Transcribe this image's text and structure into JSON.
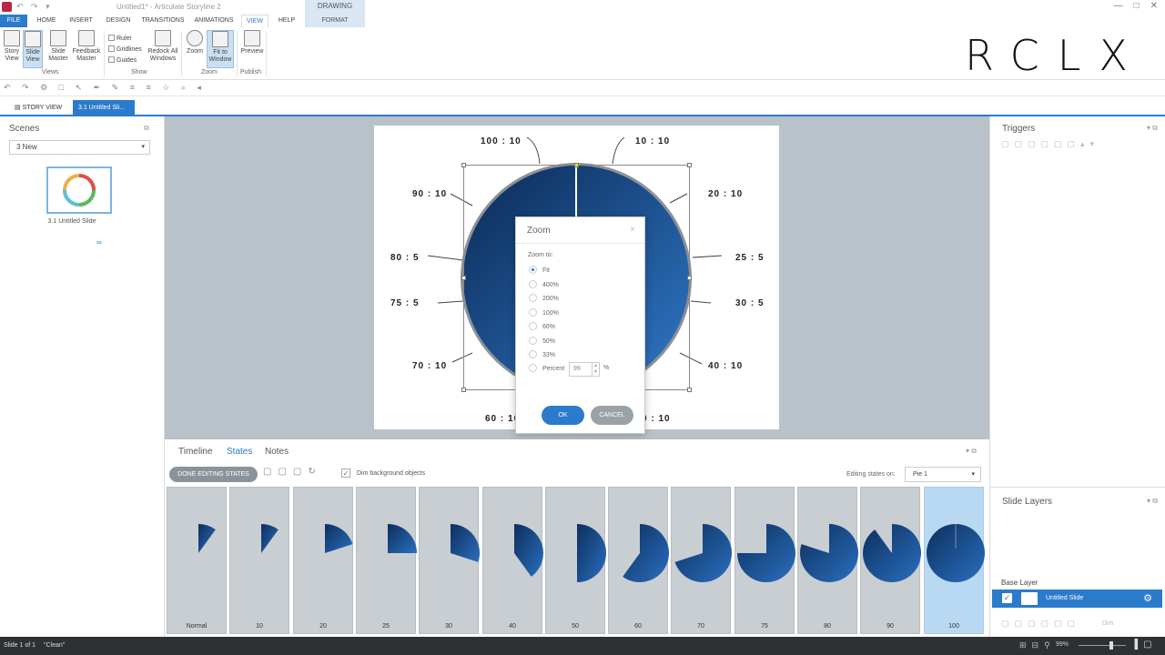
{
  "window": {
    "title": "Untitled1* - Articulate Storyline 2",
    "qat": "↶ ↷ ▾",
    "controls": [
      "—",
      "□",
      "✕"
    ],
    "contextual_group": "DRAWING TOOLS"
  },
  "ribbon_tabs": [
    "FILE",
    "HOME",
    "INSERT",
    "DESIGN",
    "TRANSITIONS",
    "ANIMATIONS",
    "VIEW",
    "HELP",
    "FORMAT"
  ],
  "ribbon": {
    "views_buttons": [
      {
        "label": "Story\nView"
      },
      {
        "label": "Slide\nView"
      },
      {
        "label": "Slide\nMaster"
      },
      {
        "label": "Feedback\nMaster"
      }
    ],
    "views_group": "Views",
    "show_checks": [
      "Ruler",
      "Gridlines",
      "Guides"
    ],
    "redock_label": "Redock All\nWindows",
    "show_group": "Show",
    "zoom_buttons": [
      {
        "label": "Zoom"
      },
      {
        "label": "Fit to\nWindow"
      }
    ],
    "zoom_group": "Zoom",
    "preview_label": "Preview",
    "publish_group": "Publish",
    "brand_logo": "RCLX"
  },
  "toolbar_icons": "↶ ↷ ⚙ □ ↖ ✒ ✎ ≡ ≡ ☆ ⌕ ◂",
  "doc_tabs": {
    "story": "STORY VIEW",
    "slide": "3.1 Untitled Sli..."
  },
  "scenes": {
    "title": "Scenes",
    "selected": "3 New",
    "thumb_label": "3.1 Untitled Slide"
  },
  "slide_labels": {
    "l100": "100 : 10",
    "l10": "10 : 10",
    "l90": "90 : 10",
    "l20": "20 : 10",
    "l80": "80 : 5",
    "l25": "25 : 5",
    "l75": "75 : 5",
    "l30": "30 : 5",
    "l70": "70 : 10",
    "l40": "40 : 10",
    "l60": "60 : 10",
    "l50": "0 : 10"
  },
  "zoom_dialog": {
    "title": "Zoom",
    "close": "×",
    "zoom_to": "Zoom to:",
    "options": [
      "Fit",
      "400%",
      "200%",
      "100%",
      "66%",
      "50%",
      "33%",
      "Percent"
    ],
    "selected_option": "Fit",
    "percent_value": "99",
    "percent_unit": "%",
    "ok": "OK",
    "cancel": "CANCEL"
  },
  "bottom": {
    "tabs": [
      "Timeline",
      "States",
      "Notes"
    ],
    "active_tab": "States",
    "done_button": "DONE EDITING STATES",
    "dim_bg": "Dim background objects",
    "dim_bg_checked": true,
    "editing_on_label": "Editing states on:",
    "editing_on_value": "Pie 1",
    "states": [
      {
        "label": "Normal",
        "fill": 0.1
      },
      {
        "label": "10",
        "fill": 0.1
      },
      {
        "label": "20",
        "fill": 0.2
      },
      {
        "label": "25",
        "fill": 0.25
      },
      {
        "label": "30",
        "fill": 0.3
      },
      {
        "label": "40",
        "fill": 0.4
      },
      {
        "label": "50",
        "fill": 0.5
      },
      {
        "label": "60",
        "fill": 0.6
      },
      {
        "label": "70",
        "fill": 0.7
      },
      {
        "label": "75",
        "fill": 0.75
      },
      {
        "label": "80",
        "fill": 0.8
      },
      {
        "label": "90",
        "fill": 0.9
      },
      {
        "label": "100",
        "fill": 1.0
      }
    ],
    "selected_state": "100"
  },
  "right_panel": {
    "triggers_title": "Triggers",
    "layers_title": "Slide Layers",
    "base_layer_label": "Base Layer",
    "base_layer_name": "Untitled Slide",
    "dim_label": "Dim"
  },
  "status": {
    "slide": "Slide 1 of 1",
    "state": "\"Clean\"",
    "zoom": "99%"
  },
  "colors": {
    "accent": "#2b7bcc",
    "pie_dark": "#0d2f5c",
    "pie_light": "#2a6fc0"
  }
}
